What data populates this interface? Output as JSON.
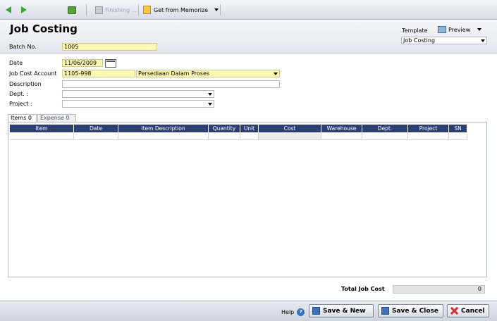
{
  "toolbar": {
    "finishing_label": "Finishing ...",
    "memorize_label": "Get from Memorize"
  },
  "header": {
    "title": "Job Costing",
    "template_label": "Template",
    "preview_label": "Preview",
    "template_value": "Job Costing"
  },
  "form": {
    "batch_label": "Batch No.",
    "batch_value": "1005",
    "date_label": "Date",
    "date_value": "11/06/2009",
    "account_label": "Job Cost Account",
    "account_code": "1105-998",
    "account_name": "Persediaan Dalam Proses",
    "description_label": "Description",
    "description_value": "",
    "dept_label": "Dept. :",
    "dept_value": "",
    "project_label": "Project :",
    "project_value": ""
  },
  "tabs": [
    {
      "label": "Items 0"
    },
    {
      "label": "Expense 0"
    }
  ],
  "grid": {
    "columns": [
      "Item",
      "Date",
      "Item Description",
      "Quantity",
      "Unit",
      "Cost",
      "Warehouse",
      "Dept.",
      "Project",
      "SN"
    ]
  },
  "totals": {
    "label": "Total Job Cost",
    "value": "0"
  },
  "footer": {
    "help_label": "Help",
    "save_new_label": "Save & New",
    "save_close_label": "Save & Close",
    "cancel_label": "Cancel"
  },
  "icons": [
    "back-arrow-icon",
    "forward-arrow-icon",
    "copy-icon",
    "finishing-icon",
    "memorize-icon",
    "preview-icon",
    "calendar-icon",
    "help-icon",
    "save-icon",
    "cancel-icon"
  ]
}
